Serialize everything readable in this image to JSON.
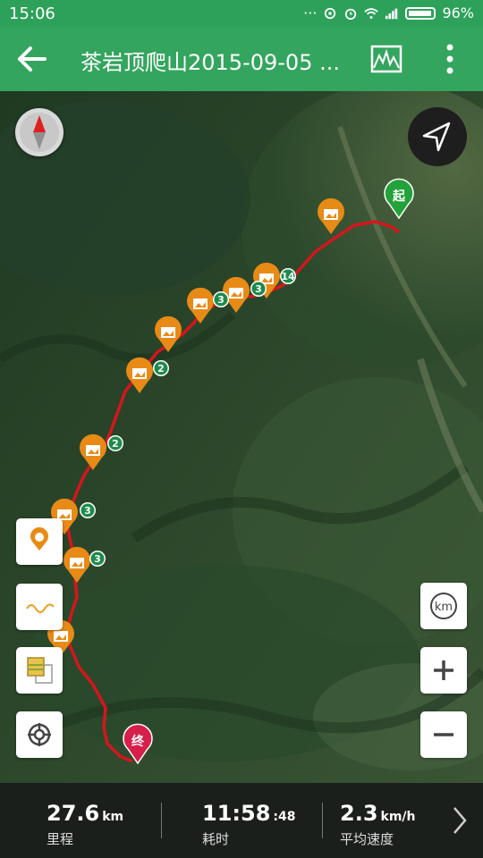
{
  "status_bar": {
    "time": "15:06",
    "battery": "96%",
    "icons": [
      "more-dots-icon",
      "sync-icon",
      "alarm-icon",
      "wifi-icon",
      "signal-icon",
      "battery-icon"
    ]
  },
  "app_bar": {
    "title": "茶岩顶爬山2015-09-05 ...",
    "back_icon": "back-arrow-icon",
    "chart_icon": "elevation-chart-icon",
    "more_icon": "overflow-menu-icon",
    "color": "#34a55e"
  },
  "map": {
    "type": "satellite",
    "route_color": "#d4161c",
    "start_label": "起",
    "end_label": "终",
    "photo_markers": 12,
    "waypoint_labels": [
      "14",
      "3",
      "3",
      "2",
      "2",
      "3",
      "3"
    ],
    "controls": {
      "compass": "compass-icon",
      "locate": "navigate-icon",
      "unit_label": "km",
      "zoom_in": "+",
      "zoom_out": "−",
      "left_buttons": [
        "pace-marker-icon",
        "elevation-line-icon",
        "layer-switch-icon",
        "tracking-target-icon"
      ]
    }
  },
  "stats": {
    "distance_value": "27.6",
    "distance_unit": "km",
    "distance_label": "里程",
    "duration_value": "11:58",
    "duration_seconds": ":48",
    "duration_label": "耗时",
    "speed_value": "2.3",
    "speed_unit": "km/h",
    "speed_label": "平均速度"
  }
}
